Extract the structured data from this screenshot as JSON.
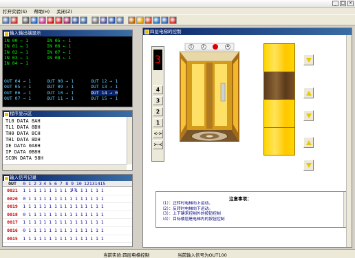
{
  "window": {
    "title": ""
  },
  "menu": {
    "items": [
      "打开实验(S)",
      "帮助(H)",
      "关闭(Z)"
    ]
  },
  "toolbar": {
    "buttons": [
      {
        "icon": "save-icon",
        "color": "#4a6aa5"
      },
      {
        "icon": "chip-icon",
        "color": "#c03030"
      },
      {
        "icon": "tool-icon",
        "color": "#5a5a5a"
      },
      {
        "icon": "chart-icon",
        "color": "#2060c0"
      },
      {
        "icon": "palette-icon",
        "color": "#c03090"
      },
      {
        "icon": "stop-icon",
        "color": "#d01010"
      },
      {
        "icon": "record-icon",
        "color": "#d02020"
      },
      {
        "icon": "target-icon",
        "color": "#a02060"
      },
      {
        "icon": "memory-icon",
        "color": "#3050a0"
      },
      {
        "icon": "keyboard-icon",
        "color": "#3060a0"
      },
      {
        "icon": "document-icon",
        "color": "#707070"
      },
      {
        "icon": "print-icon",
        "color": "#4a4a9a"
      },
      {
        "icon": "grid-icon",
        "color": "#2050b0"
      },
      {
        "icon": "table-icon",
        "color": "#5070a0"
      },
      {
        "icon": "flag-icon",
        "color": "#c06000"
      },
      {
        "icon": "help-icon",
        "color": "#e0a000"
      },
      {
        "icon": "info-icon",
        "color": "#d04020"
      },
      {
        "icon": "about-icon",
        "color": "#2070c0"
      },
      {
        "icon": "window-icon",
        "color": "#3060b0"
      },
      {
        "icon": "exit-icon",
        "color": "#d02020"
      }
    ]
  },
  "io_panel": {
    "title": "输入输出端显示",
    "inputs_left": [
      "IN 00 ← 1",
      "IN 01 ← 1",
      "IN 02 ← 1",
      "IN 03 ← 1",
      "IN 04 ← 1"
    ],
    "inputs_right": [
      "IN 05 ← 1",
      "IN 06 ← 1",
      "IN 07 ← 1",
      "IN 08 ← 1"
    ],
    "outputs_c1": [
      "OUT 04 → 1",
      "OUT 05 → 1",
      "OUT 06 → 1",
      "OUT 07 → 1"
    ],
    "outputs_c2": [
      "OUT 08 → 1",
      "OUT 09 → 1",
      "OUT 10 → 1",
      "OUT 11 → 1"
    ],
    "outputs_c3": [
      "OUT 12 → 1",
      "OUT 13 → 1",
      "OUT 14 → 0",
      "OUT 15 → 1"
    ]
  },
  "program_panel": {
    "title": "程序显示区",
    "lines": [
      "TL0  DATA  8AH",
      "TL1  DATA  8BH",
      "TH0  DATA  8CH",
      "TH1  DATA  8DH",
      "IE   DATA  0A8H",
      "IP   DATA  0B8H",
      "SCON  DATA  98H"
    ]
  },
  "record_panel": {
    "title": "输入信号记录",
    "headers": [
      "OUT",
      "0 1 2 3",
      "4 5 6 7",
      "8 9 10 11",
      "12131415"
    ],
    "rows": [
      [
        "0021",
        "1 1 1 1",
        "1 1 1 1",
        "1 1 1 1",
        "1 1 1 1"
      ],
      [
        "0020",
        "0 1 1 1",
        "1 1 1 1",
        "1 1 1 1",
        "1 1 1 1"
      ],
      [
        "0019",
        "1 1 1 1",
        "1 1 1 1",
        "1 1 1 1",
        "1 1 1 1"
      ],
      [
        "0018",
        "0 1 1 1",
        "1 1 1 1",
        "1 1 1 1",
        "1 1 1 1"
      ],
      [
        "0017",
        "1 1 1 1",
        "1 1 1 1",
        "1 1 1 1",
        "1 1 1 1"
      ],
      [
        "0016",
        "0 1 1 1",
        "1 1 1 1",
        "1 1 1 1",
        "1 1 1 1"
      ],
      [
        "0015",
        "1 1 1 1",
        "1 1 1 1",
        "1 1 1 1",
        "1 1 1 1"
      ]
    ]
  },
  "elevator": {
    "title": "四层电梯的控制",
    "floor_display": "3",
    "floor_buttons": [
      "4",
      "3",
      "2",
      "1",
      "<->",
      ">-<"
    ],
    "indicator_marks": [
      "1",
      "2",
      "●",
      "4"
    ],
    "shaft_car_floor": 3
  },
  "notes": {
    "title": "注意事项：",
    "lines": [
      "（1）：正转时电梯向上运动。",
      "（2）：反转时电梯向下运动。",
      "（3）：上下键来控制外的按钮控制",
      "（4）：目标楼层是电梯内的按钮控制"
    ]
  },
  "status": {
    "experiment": "当前实验:四层电梯控制",
    "signal": "当前输入信号为OUT100"
  }
}
